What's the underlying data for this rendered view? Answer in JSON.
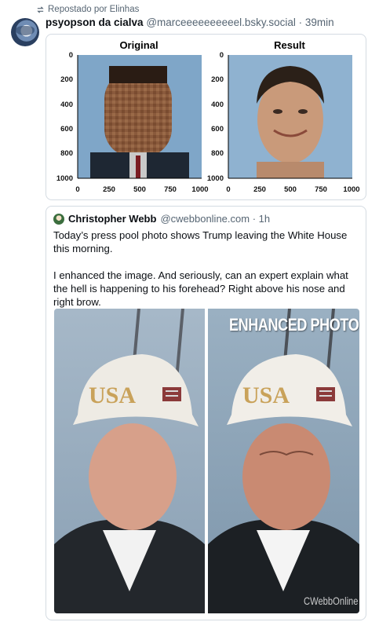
{
  "repost": {
    "label": "Repostado por Elinhas"
  },
  "post": {
    "display_name": "psyopson da cialva",
    "handle": "@marceeeeeeeeeel.bsky.social",
    "separator": " · ",
    "time": "39min"
  },
  "embedded_chart": {
    "panels": [
      {
        "title": "Original",
        "yticks": [
          "0",
          "200",
          "400",
          "600",
          "800",
          "1000"
        ],
        "xticks": [
          "0",
          "250",
          "500",
          "750",
          "1000"
        ]
      },
      {
        "title": "Result",
        "yticks": [
          "0",
          "200",
          "400",
          "600",
          "800",
          "1000"
        ],
        "xticks": [
          "0",
          "250",
          "500",
          "750",
          "1000"
        ]
      }
    ]
  },
  "quote": {
    "display_name": "Christopher Webb",
    "handle": "@cwebbonline.com",
    "separator": " · ",
    "time": "1h",
    "paragraph1": "Today’s press pool photo shows Trump leaving the White House this morning.",
    "paragraph2": "I enhanced the image. And  seriously, can an expert explain what the hell is happening to his forehead? Right above his nose and right brow.",
    "photo_caption": "ENHANCED PHOTO",
    "photo_watermark": "CWebbOnline",
    "cap_text": "USA"
  },
  "colors": {
    "muted": "#566573",
    "border": "#d4dbe2",
    "sky": "#9fb4c6",
    "cap": "#f1eee8",
    "cap_text": "#c9a25a"
  }
}
